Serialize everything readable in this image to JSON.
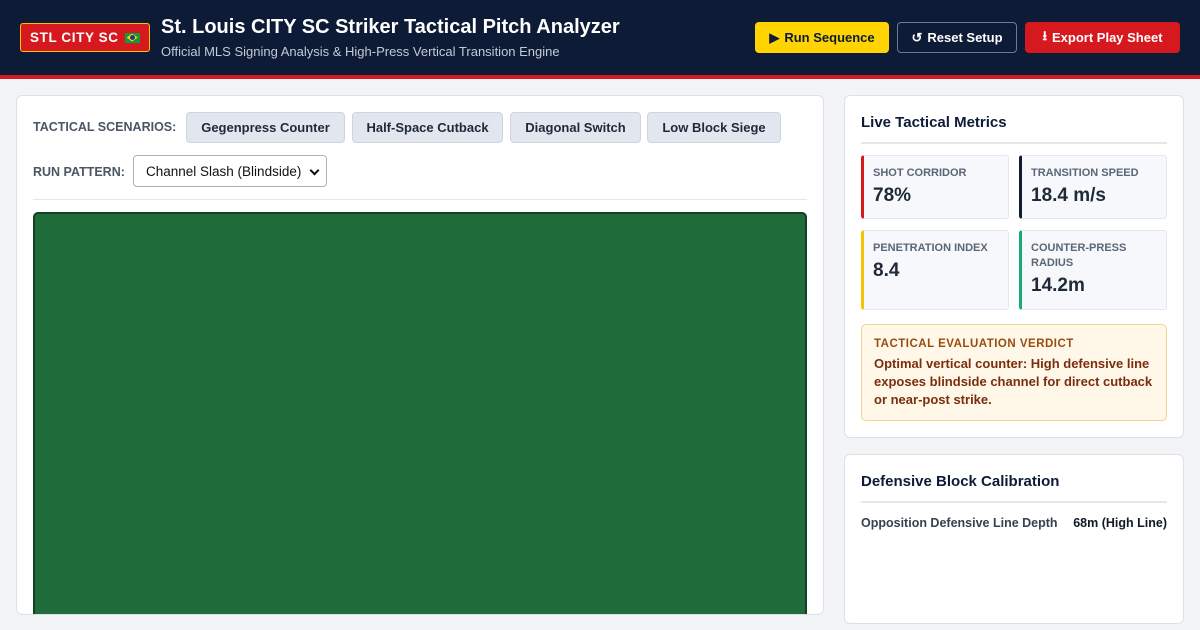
{
  "header": {
    "badge_label": "STL CITY SC",
    "title": "St. Louis CITY SC Striker Tactical Pitch Analyzer",
    "subtitle": "Official MLS Signing Analysis & High-Press Vertical Transition Engine",
    "buttons": {
      "run": {
        "icon": "▶",
        "label": "Run Sequence"
      },
      "reset": {
        "icon": "↺",
        "label": "Reset Setup"
      },
      "export": {
        "icon": "⭳",
        "label": "Export Play Sheet"
      }
    }
  },
  "controls": {
    "scenarios_label": "TACTICAL SCENARIOS:",
    "scenarios": [
      "Gegenpress Counter",
      "Half-Space Cutback",
      "Diagonal Switch",
      "Low Block Siege"
    ],
    "run_pattern_label": "RUN PATTERN:",
    "run_pattern_value": "Channel Slash (Blindside)"
  },
  "metrics": {
    "title": "Live Tactical Metrics",
    "items": [
      {
        "label": "SHOT CORRIDOR",
        "value": "78%",
        "accent": "#d6191f"
      },
      {
        "label": "TRANSITION SPEED",
        "value": "18.4 m/s",
        "accent": "#0d1b36"
      },
      {
        "label": "PENETRATION INDEX",
        "value": "8.4",
        "accent": "#f5c400"
      },
      {
        "label": "COUNTER-PRESS RADIUS",
        "value": "14.2m",
        "accent": "#19a974"
      }
    ],
    "verdict_label": "TACTICAL EVALUATION VERDICT",
    "verdict_text": "Optimal vertical counter: High defensive line exposes blindside channel for direct cutback or near-post strike."
  },
  "calibration": {
    "title": "Defensive Block Calibration",
    "rows": [
      {
        "label": "Opposition Defensive Line Depth",
        "value": "68m (High Line)"
      }
    ]
  },
  "colors": {
    "navy": "#0d1b36",
    "red": "#d6191f",
    "yellow": "#ffd400",
    "pitch_green": "#1f6b3a"
  }
}
